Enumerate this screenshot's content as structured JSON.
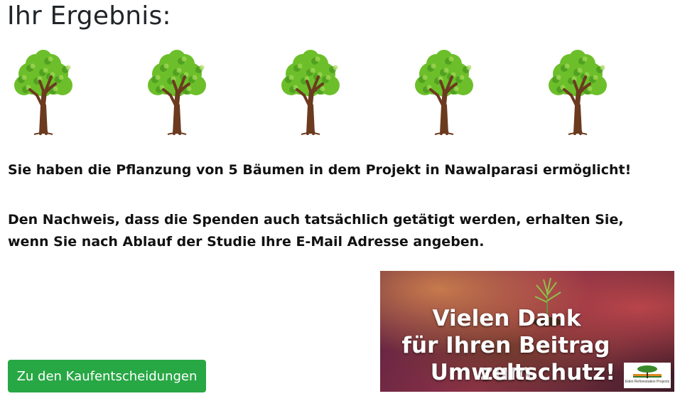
{
  "result": {
    "title": "Ihr Ergebnis:",
    "tree_count": 5,
    "trees": [
      {
        "icon": "tree-icon"
      },
      {
        "icon": "tree-icon"
      },
      {
        "icon": "tree-icon"
      },
      {
        "icon": "tree-icon"
      },
      {
        "icon": "tree-icon"
      }
    ],
    "message_planting": "Sie haben die Pflanzung von 5 Bäumen in dem Projekt in Nawalparasi ermöglicht!",
    "message_proof": "Den Nachweis, dass die Spenden auch tatsächlich getätigt werden, erhalten Sie, wenn Sie nach Ablauf der Studie Ihre E-Mail Adresse angeben."
  },
  "actions": {
    "continue_label": "Zu den Kaufentscheidungen",
    "button_color": "#28a745"
  },
  "banner": {
    "line1": "Vielen Dank",
    "line2": "für Ihren Beitrag zum",
    "line3": "Umweltschutz!",
    "logo_text": "Eden Reforestation Projects"
  },
  "colors": {
    "foliage": "#6cbf2a",
    "trunk": "#6b3a1f"
  }
}
